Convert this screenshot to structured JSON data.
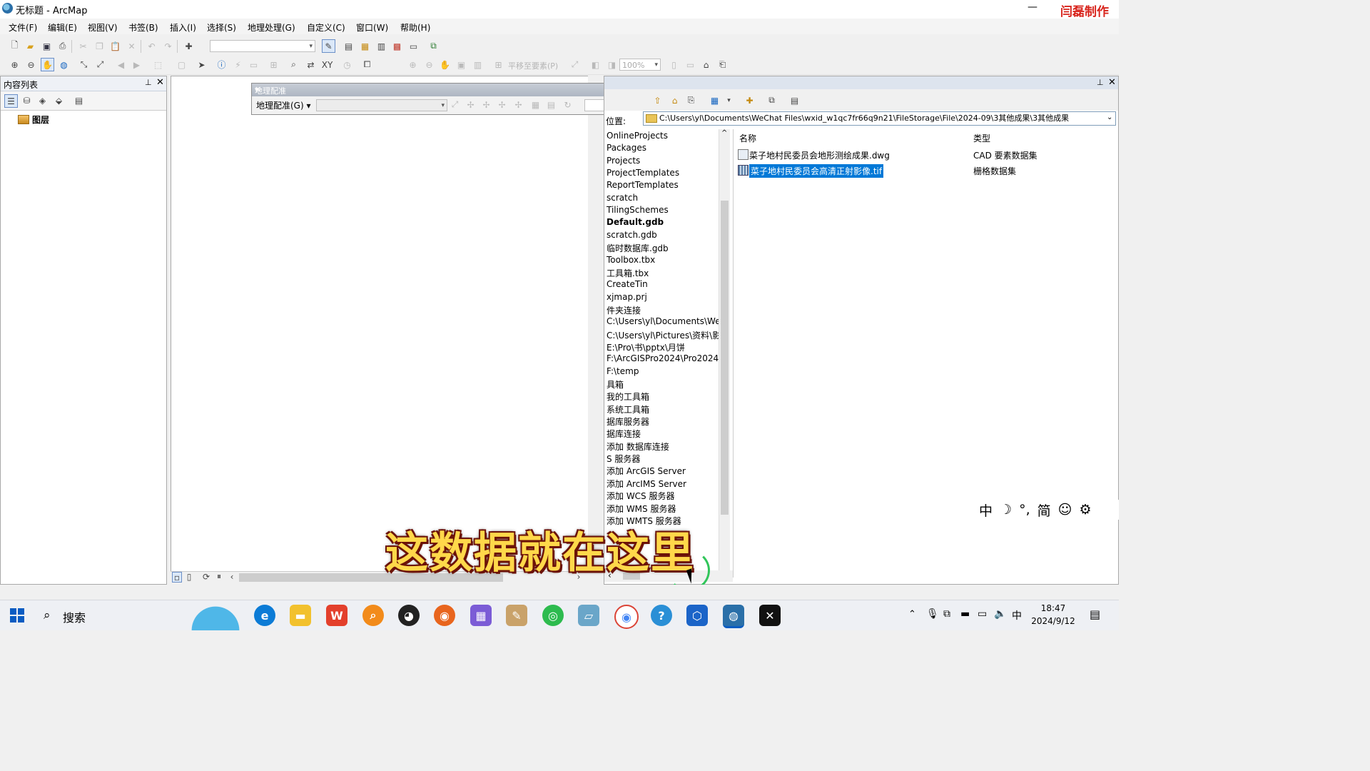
{
  "window": {
    "title": "无标题 - ArcMap",
    "minimize": "—",
    "watermark": "闫磊制作"
  },
  "menu": [
    "文件(F)",
    "编辑(E)",
    "视图(V)",
    "书签(B)",
    "插入(I)",
    "选择(S)",
    "地理处理(G)",
    "自定义(C)",
    "窗口(W)",
    "帮助(H)"
  ],
  "toolbar2": {
    "pan_to_features": "平移至要素(P)",
    "zoom": "100%"
  },
  "toc": {
    "title": "内容列表",
    "layers_label": "图层"
  },
  "georef": {
    "title": "地理配准",
    "menu": "地理配准(G) ▾"
  },
  "catalog": {
    "location_label": "位置:",
    "location_path": "C:\\Users\\yl\\Documents\\WeChat Files\\wxid_w1qc7fr66q9n21\\FileStorage\\File\\2024-09\\3其他成果\\3其他成果",
    "tree": [
      "OnlineProjects",
      "Packages",
      "Projects",
      "ProjectTemplates",
      "ReportTemplates",
      "scratch",
      "TilingSchemes",
      "Default.gdb",
      "scratch.gdb",
      "临时数据库.gdb",
      "Toolbox.tbx",
      "工具箱.tbx",
      "CreateTin",
      "xjmap.prj",
      "件夹连接",
      "C:\\Users\\yl\\Documents\\We",
      "C:\\Users\\yl\\Pictures\\资料\\影",
      "E:\\Pro\\书\\pptx\\月饼",
      "F:\\ArcGISPro2024\\Pro2024",
      "F:\\temp",
      "具箱",
      "我的工具箱",
      "系统工具箱",
      "据库服务器",
      "据库连接",
      "添加 数据库连接",
      "S 服务器",
      "添加 ArcGIS Server",
      "添加 ArcIMS Server",
      "添加 WCS 服务器",
      "添加 WMS 服务器",
      "添加 WMTS 服务器"
    ],
    "columns": {
      "name": "名称",
      "type": "类型"
    },
    "rows": [
      {
        "name": "菜子地村民委员会地形测绘成果.dwg",
        "type": "CAD 要素数据集"
      },
      {
        "name": "菜子地村民委员会高清正射影像.tif",
        "type": "栅格数据集"
      }
    ]
  },
  "ime": [
    "中",
    "☽",
    "°,",
    "简",
    "☺",
    "⚙"
  ],
  "subtitle": "这数据就在这里",
  "taskbar": {
    "search": "搜索",
    "time": "18:47",
    "date": "2024/9/12",
    "lang": "中"
  }
}
